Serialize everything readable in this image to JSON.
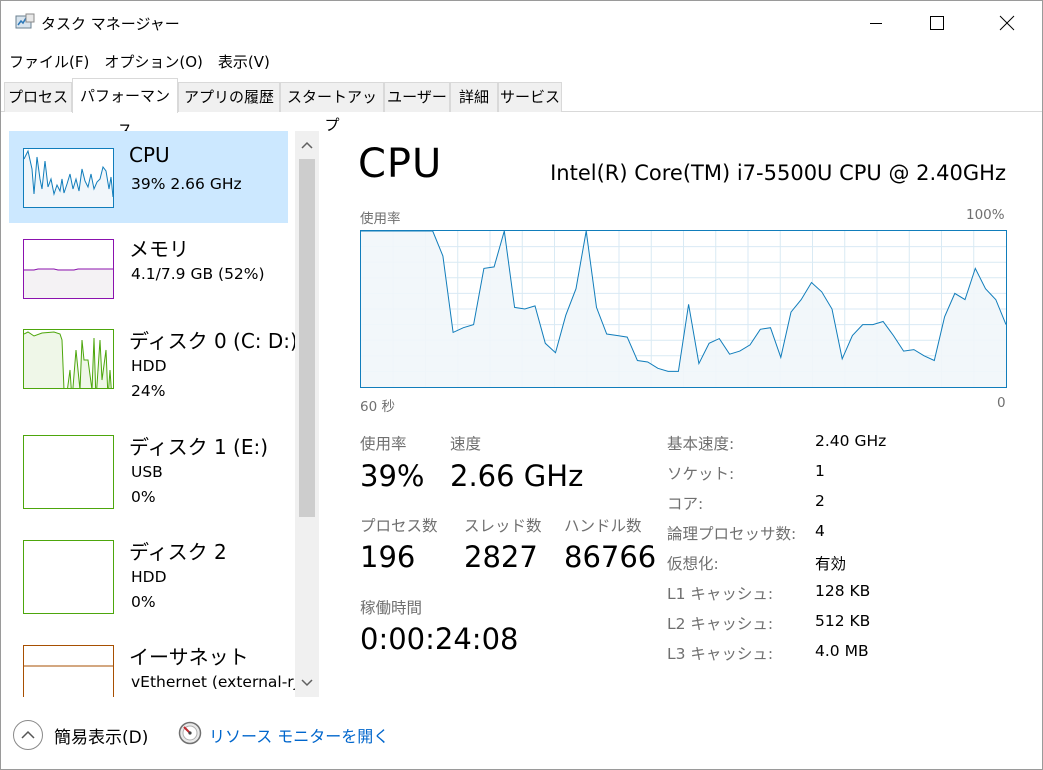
{
  "window": {
    "title": "タスク マネージャー"
  },
  "menu": {
    "items": [
      "ファイル(F)",
      "オプション(O)",
      "表示(V)"
    ]
  },
  "tabs": [
    {
      "label": "プロセス",
      "active": false
    },
    {
      "label": "パフォーマンス",
      "active": true
    },
    {
      "label": "アプリの履歴",
      "active": false
    },
    {
      "label": "スタートアップ",
      "active": false
    },
    {
      "label": "ユーザー",
      "active": false
    },
    {
      "label": "詳細",
      "active": false
    },
    {
      "label": "サービス",
      "active": false
    }
  ],
  "sidebar": {
    "items": [
      {
        "title": "CPU",
        "line1": "39%  2.66 GHz",
        "line2": "",
        "color": "#117dbb"
      },
      {
        "title": "メモリ",
        "line1": "4.1/7.9 GB (52%)",
        "line2": "",
        "color": "#8b12ae"
      },
      {
        "title": "ディスク 0 (C: D:)",
        "line1": "HDD",
        "line2": "24%",
        "color": "#4da60c"
      },
      {
        "title": "ディスク 1 (E:)",
        "line1": "USB",
        "line2": "0%",
        "color": "#4da60c"
      },
      {
        "title": "ディスク 2",
        "line1": "HDD",
        "line2": "0%",
        "color": "#4da60c"
      },
      {
        "title": "イーサネット",
        "line1": "vEthernet (external-rj",
        "line2": "",
        "color": "#a74f01"
      }
    ]
  },
  "cpu": {
    "heading": "CPU",
    "model": "Intel(R) Core(TM) i7-5500U CPU @ 2.40GHz",
    "graph_label": "使用率",
    "graph_max": "100%",
    "graph_time_left": "60 秒",
    "graph_time_right": "0",
    "usage_history_percent": [
      100,
      100,
      100,
      100,
      100,
      100,
      100,
      100,
      84,
      35,
      38,
      40,
      76,
      77,
      100,
      51,
      50,
      52,
      28,
      22,
      46,
      63,
      100,
      51,
      34,
      33,
      32,
      17,
      16,
      12,
      10,
      10,
      53,
      15,
      28,
      31,
      21,
      23,
      27,
      37,
      38,
      19,
      48,
      56,
      67,
      61,
      50,
      18,
      33,
      40,
      40,
      42,
      33,
      23,
      24,
      20,
      17,
      45,
      60,
      56,
      76,
      63,
      56,
      40
    ],
    "stats": {
      "usage_label": "使用率",
      "usage_value": "39%",
      "speed_label": "速度",
      "speed_value": "2.66 GHz",
      "processes_label": "プロセス数",
      "processes_value": "196",
      "threads_label": "スレッド数",
      "threads_value": "2827",
      "handles_label": "ハンドル数",
      "handles_value": "86766",
      "uptime_label": "稼働時間",
      "uptime_value": "0:00:24:08"
    },
    "specs": [
      {
        "label": "基本速度:",
        "value": "2.40 GHz"
      },
      {
        "label": "ソケット:",
        "value": "1"
      },
      {
        "label": "コア:",
        "value": "2"
      },
      {
        "label": "論理プロセッサ数:",
        "value": "4"
      },
      {
        "label": "仮想化:",
        "value": "有効"
      },
      {
        "label": "L1 キャッシュ:",
        "value": "128 KB"
      },
      {
        "label": "L2 キャッシュ:",
        "value": "512 KB"
      },
      {
        "label": "L3 キャッシュ:",
        "value": "4.0 MB"
      }
    ]
  },
  "footer": {
    "fewer_details": "簡易表示(D)",
    "resource_monitor": "リソース モニターを開く"
  },
  "colors": {
    "cpu_line": "#117dbb",
    "cpu_fill": "#f1f6fa",
    "grid": "#d9eaf4",
    "selected_bg": "#cce8ff",
    "link": "#0066cc"
  }
}
